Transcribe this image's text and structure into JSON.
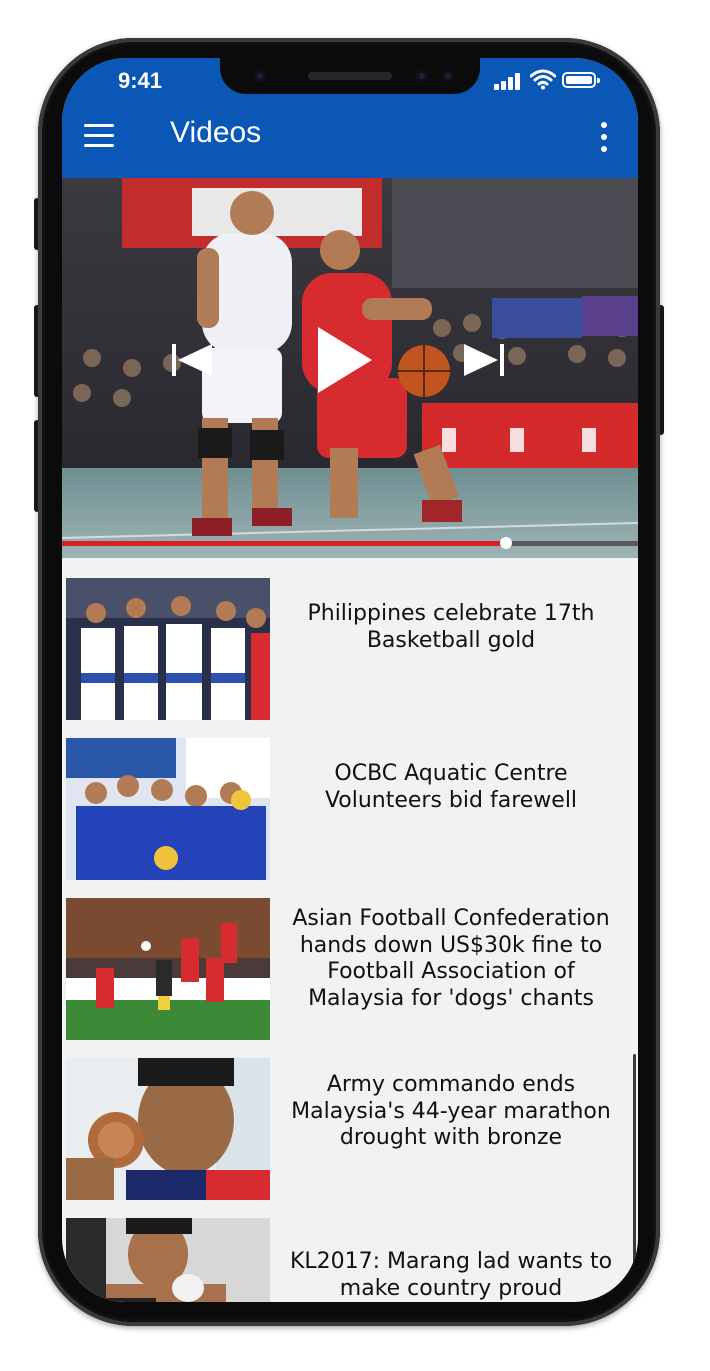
{
  "status_bar": {
    "time": "9:41"
  },
  "app_bar": {
    "title": "Videos",
    "menu_icon": "hamburger-menu-icon",
    "more_icon": "more-vertical-icon"
  },
  "player": {
    "progress": 0.77,
    "controls": {
      "previous": "skip-previous-icon",
      "play": "play-icon",
      "next": "skip-next-icon"
    }
  },
  "videos": [
    {
      "title": "Philippines celebrate 17th Basketball gold"
    },
    {
      "title": "OCBC Aquatic Centre Volunteers bid farewell"
    },
    {
      "title": "Asian Football Confederation hands down US$30k fine to Football Association of Malaysia for 'dogs' chants"
    },
    {
      "title": "Army commando ends Malaysia's 44-year marathon drought with bronze"
    },
    {
      "title": "KL2017: Marang lad wants to make country proud"
    }
  ],
  "colors": {
    "app_bar": "#0a57b5",
    "progress": "#d72027",
    "background": "#f2f2f5"
  }
}
